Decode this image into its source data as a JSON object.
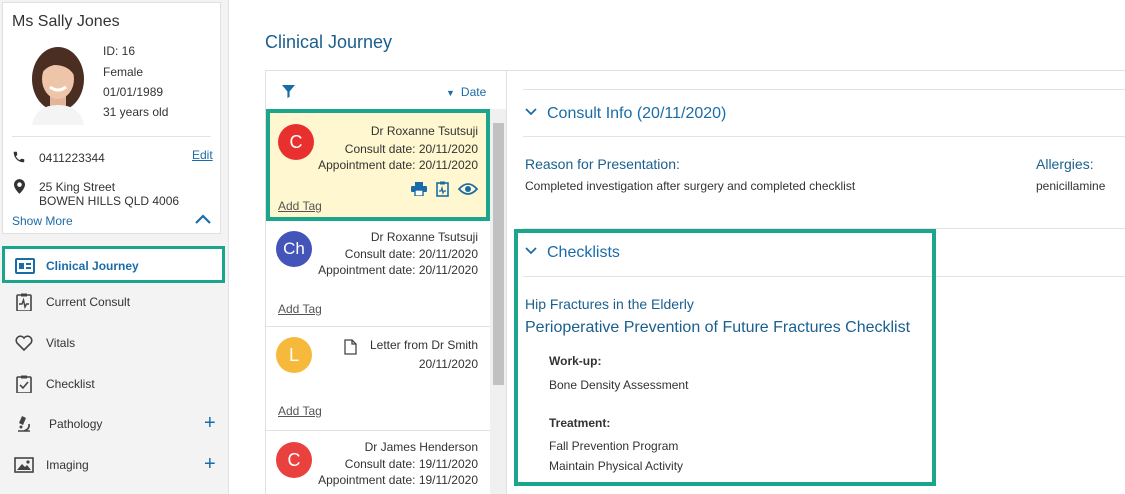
{
  "patient": {
    "name": "Ms Sally Jones",
    "id_line": "ID: 16",
    "gender": "Female",
    "dob": "01/01/1989",
    "age": "31 years old",
    "phone": "0411223344",
    "edit_label": "Edit",
    "address_line1": "25 King Street",
    "address_line2": "BOWEN HILLS QLD 4006",
    "show_more": "Show More"
  },
  "nav": {
    "items": [
      {
        "label": "Clinical Journey",
        "icon": "clinical-journey-icon"
      },
      {
        "label": "Current Consult",
        "icon": "consult-icon"
      },
      {
        "label": "Vitals",
        "icon": "heart-icon"
      },
      {
        "label": "Checklist",
        "icon": "clipboard-check-icon"
      },
      {
        "label": "Pathology",
        "icon": "microscope-icon",
        "plus": "+"
      },
      {
        "label": "Imaging",
        "icon": "image-icon",
        "plus": "+"
      }
    ]
  },
  "main": {
    "title": "Clinical Journey",
    "sort_label": "Date"
  },
  "cards": [
    {
      "letter": "C",
      "color": "#e8312f",
      "doctor": "Dr Roxanne Tsutsuji",
      "consult": "Consult date: 20/11/2020",
      "appt": "Appointment date: 20/11/2020",
      "add_tag": "Add Tag"
    },
    {
      "letter": "Ch",
      "color": "#4355b9",
      "doctor": "Dr Roxanne Tsutsuji",
      "consult": "Consult date: 20/11/2020",
      "appt": "Appointment date: 20/11/2020",
      "add_tag": "Add Tag"
    },
    {
      "letter": "L",
      "color": "#f6b93b",
      "doctor": "Letter from Dr Smith",
      "consult": "20/11/2020",
      "add_tag": "Add Tag"
    },
    {
      "letter": "C",
      "color": "#e8413e",
      "doctor": "Dr James Henderson",
      "consult": "Consult date: 19/11/2020",
      "appt": "Appointment date: 19/11/2020"
    }
  ],
  "detail": {
    "consult_heading": "Consult Info (20/11/2020)",
    "reason_label": "Reason for Presentation:",
    "reason_text": "Completed investigation after surgery and completed checklist",
    "allergies_label": "Allergies:",
    "allergies_text": "penicillamine",
    "checklists_heading": "Checklists",
    "checklist_group": "Hip Fractures in the Elderly",
    "checklist_title": "Perioperative Prevention of Future Fractures Checklist",
    "workup_label": "Work-up:",
    "workup_items": [
      "Bone Density Assessment"
    ],
    "treatment_label": "Treatment:",
    "treatment_items": [
      "Fall Prevention Program",
      "Maintain Physical Activity"
    ]
  },
  "colors": {
    "accent": "#1a6ca8",
    "highlight": "#1aa58c",
    "selected_bg": "#fff7cf"
  }
}
